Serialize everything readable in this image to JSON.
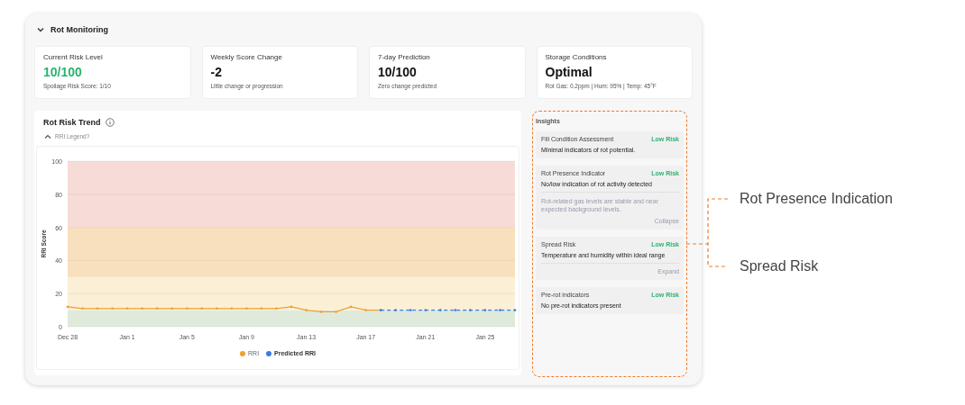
{
  "section": {
    "title": "Rot Monitoring",
    "expanded": true
  },
  "metrics": [
    {
      "label": "Current Risk Level",
      "value": "10/100",
      "note": "Spoilage Risk Score: 1/10",
      "highlight": true
    },
    {
      "label": "Weekly Score Change",
      "value": "-2",
      "note": "Little change or progression",
      "highlight": false
    },
    {
      "label": "7-day Prediction",
      "value": "10/100",
      "note": "Zero change predicted",
      "highlight": false
    },
    {
      "label": "Storage Conditions",
      "value": "Optimal",
      "note": "Rot Gas: 0.2ppm | Hum: 95% | Temp:  45°F",
      "highlight": false
    }
  ],
  "trend": {
    "title": "Rot Risk Trend",
    "legend_toggle": "RRI Legend?",
    "legend_expanded": true,
    "chart_data": {
      "type": "line",
      "ylabel": "RRI Score",
      "grid": true,
      "legend": "bottom",
      "bands": [
        {
          "axis": "y",
          "from": 0,
          "to": 10,
          "color": "#dfeadb"
        },
        {
          "axis": "y",
          "from": 10,
          "to": 30,
          "color": "#fbf0d6"
        },
        {
          "axis": "y",
          "from": 30,
          "to": 60,
          "color": "#f8dfbd"
        },
        {
          "axis": "y",
          "from": 60,
          "to": 100,
          "color": "#f7dbd7"
        }
      ],
      "categories": [
        "Dec 28",
        null,
        null,
        null,
        "Jan 1",
        null,
        null,
        null,
        "Jan 5",
        null,
        null,
        null,
        "Jan 9",
        null,
        null,
        null,
        "Jan 13",
        null,
        null,
        null,
        "Jan 17",
        null,
        null,
        null,
        "Jan 21",
        null,
        null,
        null,
        "Jan 25",
        null,
        null
      ],
      "ylim": [
        0,
        100
      ],
      "yticks": [
        0,
        20,
        40,
        60,
        80,
        100
      ],
      "series": [
        {
          "name": "RRI",
          "color": "#f0a030",
          "values": [
            12,
            11,
            11,
            11,
            11,
            11,
            11,
            11,
            11,
            11,
            11,
            11,
            11,
            11,
            11,
            12,
            10,
            9,
            9,
            12,
            10,
            10,
            null,
            null,
            null,
            null,
            null,
            null,
            null,
            null,
            null
          ]
        },
        {
          "name": "Predicted RRI",
          "color": "#3b7be8",
          "line_style": "dashed",
          "values": [
            null,
            null,
            null,
            null,
            null,
            null,
            null,
            null,
            null,
            null,
            null,
            null,
            null,
            null,
            null,
            null,
            null,
            null,
            null,
            null,
            null,
            10,
            10,
            10,
            10,
            10,
            10,
            10,
            10,
            10,
            10
          ]
        }
      ]
    }
  },
  "insights": {
    "title": "Insights",
    "items": [
      {
        "title": "Fill Condition Assessment",
        "status": "Low Risk",
        "description": "Minimal indicators of rot potential."
      },
      {
        "title": "Rot Presence Indicator",
        "status": "Low Risk",
        "description": "No/low indication of rot activity detected",
        "detail": "Rot-related gas levels are stable and near expected background levels.",
        "toggle": "Collapse"
      },
      {
        "title": "Spread Risk",
        "status": "Low Risk",
        "description": "Temperature and humidity within ideal range",
        "toggle": "Expand"
      },
      {
        "title": "Pre-rot indicators",
        "status": "Low Risk",
        "description": "No pre-rot indicators present"
      }
    ]
  },
  "callouts": [
    "Rot Presence Indication",
    "Spread Risk"
  ]
}
